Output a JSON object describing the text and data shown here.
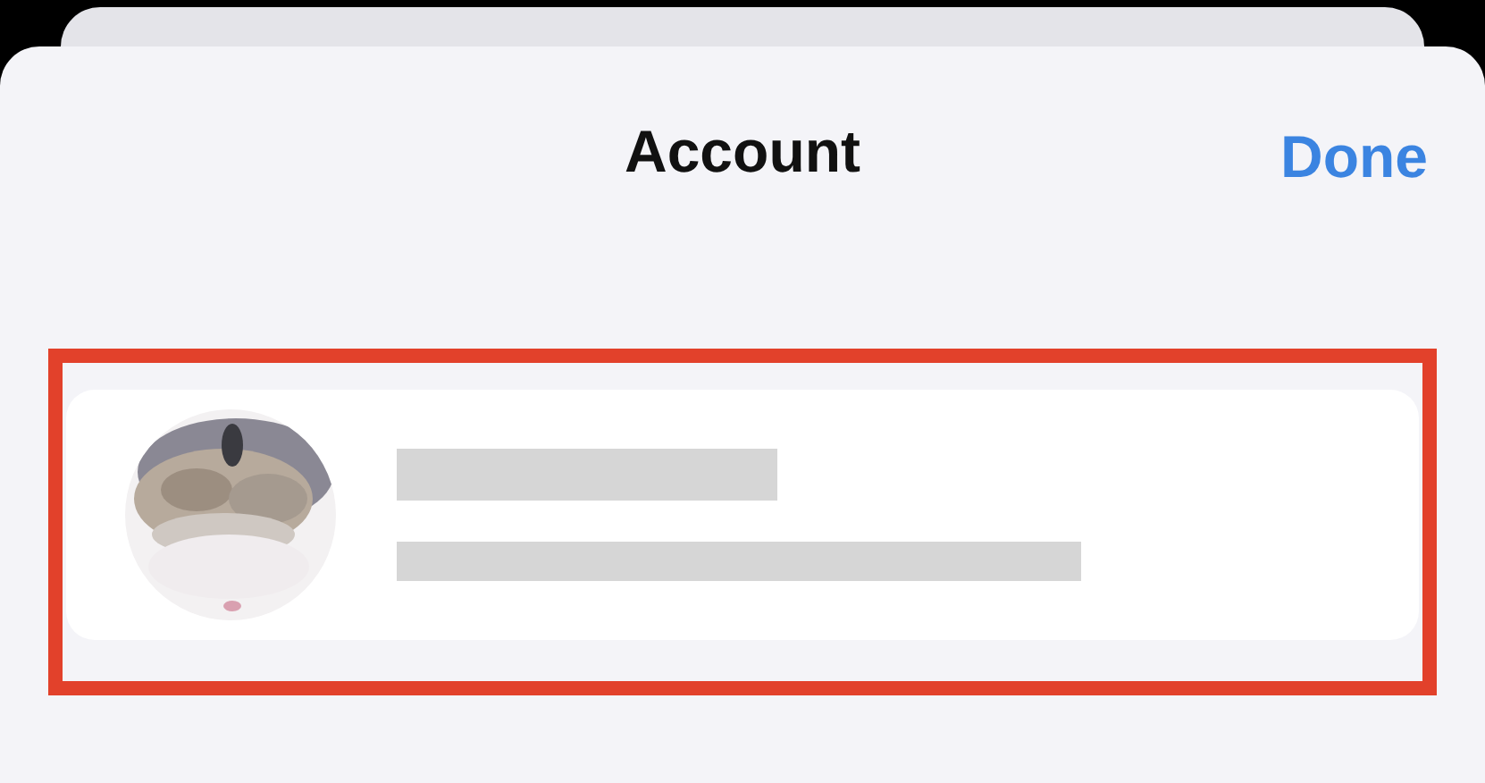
{
  "sheet": {
    "title": "Account",
    "done_button": "Done"
  },
  "account_row": {
    "highlighted": true,
    "name_redacted": true,
    "email_redacted": true
  }
}
